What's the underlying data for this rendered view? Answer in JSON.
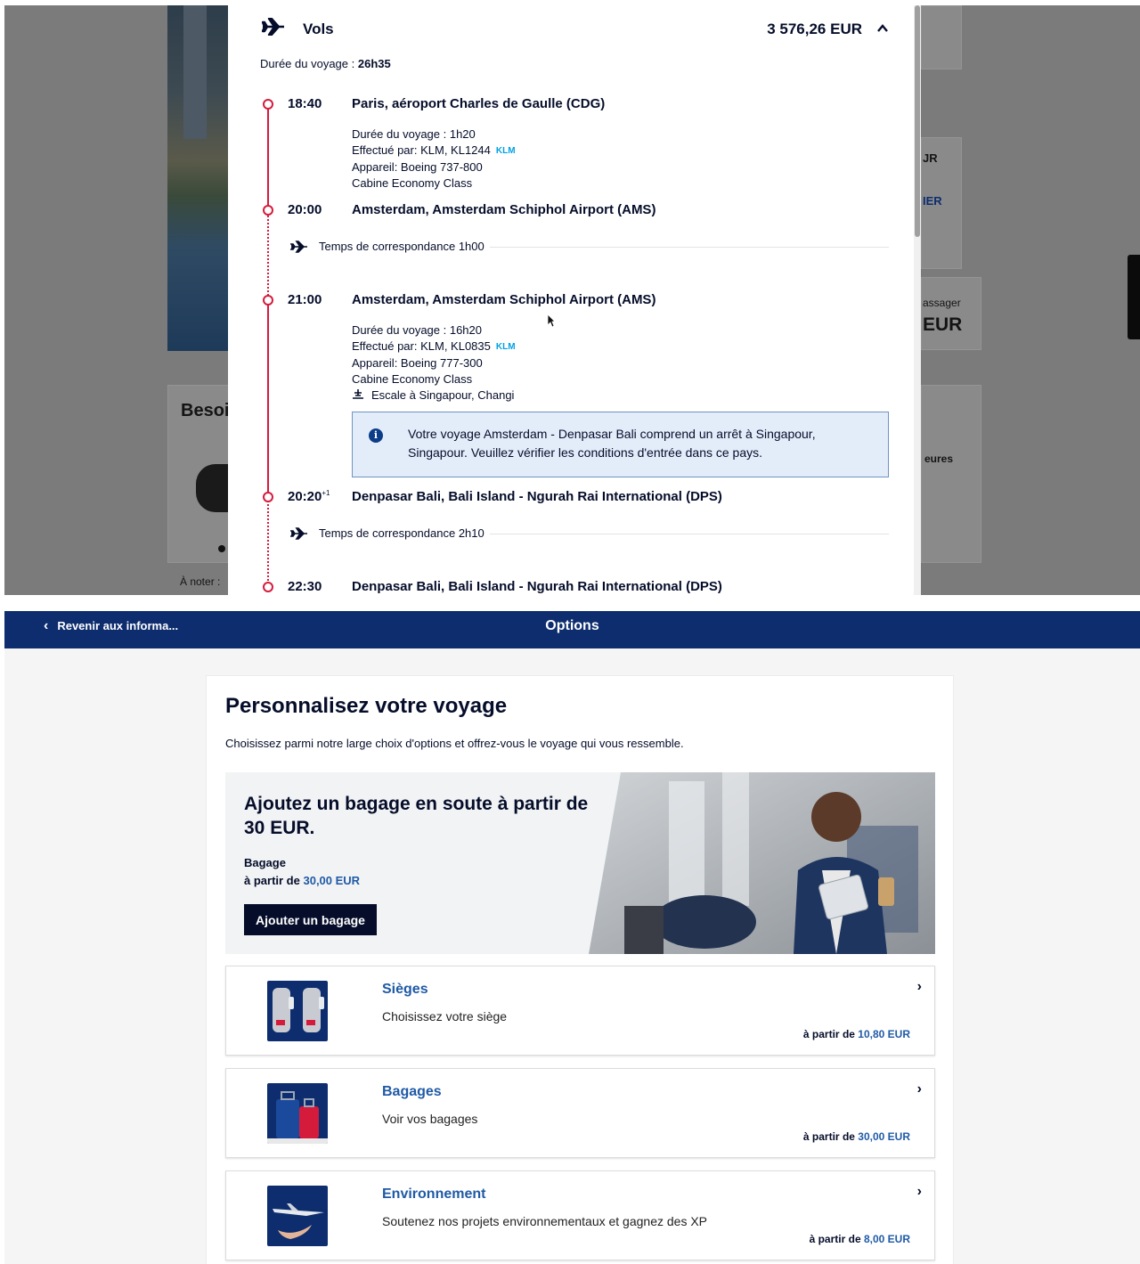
{
  "flight_panel": {
    "section_title": "Vols",
    "total_price": "3 576,26 EUR",
    "trip_duration_label": "Durée du voyage :",
    "trip_duration": "26h35",
    "segments": [
      {
        "time": "18:40",
        "place": "Paris, aéroport Charles de Gaulle (CDG)",
        "details": [
          "Durée du voyage : 1h20",
          "Effectué par: KLM, KL1244",
          "Appareil: Boeing 737-800",
          "Cabine Economy Class"
        ]
      },
      {
        "time": "20:00",
        "place": "Amsterdam, Amsterdam Schiphol Airport (AMS)"
      },
      {
        "time": "21:00",
        "place": "Amsterdam, Amsterdam Schiphol Airport (AMS)",
        "details": [
          "Durée du voyage : 16h20",
          "Effectué par: KLM, KL0835",
          "Appareil: Boeing 777-300",
          "Cabine Economy Class"
        ],
        "stopover": "Escale à Singapour, Changi"
      },
      {
        "time": "20:20",
        "time_suffix": "+1",
        "place": "Denpasar Bali, Bali Island - Ngurah Rai International (DPS)"
      },
      {
        "time": "22:30",
        "place": "Denpasar Bali, Bali Island - Ngurah Rai International (DPS)"
      }
    ],
    "connections": [
      "Temps de correspondance 1h00",
      "Temps de correspondance 2h10"
    ],
    "info_notice": "Votre voyage Amsterdam - Denpasar Bali comprend un arrêt à Singapour, Singapour. Veuillez vérifier les conditions d'entrée dans ce pays.",
    "airline_logo": "KLM",
    "background_fragments": {
      "left_heading": "Besoi",
      "left_note": "À noter :",
      "right_1": "JR",
      "right_2": "IER",
      "right_3": "assager",
      "right_4": "EUR",
      "right_5": "eures"
    }
  },
  "nav": {
    "back_label": "Revenir aux informa...",
    "title": "Options"
  },
  "page": {
    "title": "Personnalisez votre voyage",
    "subtitle": "Choisissez parmi notre large choix d'options et offrez-vous le voyage qui vous ressemble."
  },
  "promo": {
    "title": "Ajoutez un bagage en soute à partir de 30 EUR.",
    "label": "Bagage",
    "price_prefix": "à partir de",
    "price": "30,00 EUR",
    "button_label": "Ajouter un bagage"
  },
  "options": [
    {
      "title": "Sièges",
      "description": "Choisissez votre siège",
      "price_prefix": "à partir de",
      "price": "10,80 EUR",
      "icon": "seats-icon"
    },
    {
      "title": "Bagages",
      "description": "Voir vos bagages",
      "price_prefix": "à partir de",
      "price": "30,00 EUR",
      "icon": "luggage-icon"
    },
    {
      "title": "Environnement",
      "description": "Soutenez nos projets environnementaux et gagnez des XP",
      "price_prefix": "à partir de",
      "price": "8,00 EUR",
      "icon": "environment-icon"
    }
  ],
  "colors": {
    "brand_navy": "#0d2d6e",
    "accent_blue": "#1f5aa6",
    "timeline_red": "#d51b3c",
    "dark_button": "#050d2a",
    "info_bg": "#e3edfa"
  }
}
